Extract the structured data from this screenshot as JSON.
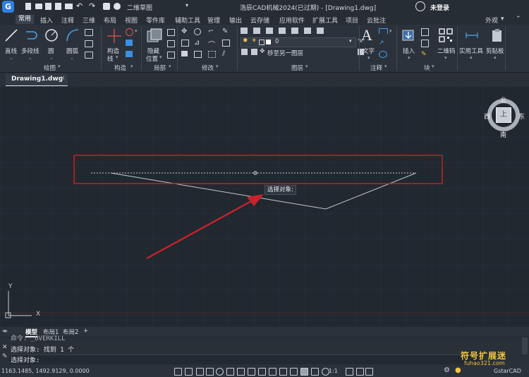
{
  "titlebar": {
    "workspace": "二维草图",
    "title": "浩辰CAD机械2024(已过期) - [Drawing1.dwg]",
    "user": "未登录"
  },
  "ribbon_tabs": [
    "常用",
    "插入",
    "注释",
    "三维",
    "布局",
    "视图",
    "零件库",
    "辅助工具",
    "管理",
    "输出",
    "云存储",
    "应用软件",
    "扩展工具",
    "项目",
    "云批注"
  ],
  "ribbon_right": "外观",
  "tools": {
    "line": "直线",
    "polyline": "多段线",
    "circle": "圆",
    "arc": "圆弧",
    "construct": "构造",
    "construct_line": "线",
    "hide": "隐藏",
    "position": "位置",
    "layer_value": "0",
    "layer_move": "移至另一图层",
    "text": "文字",
    "insert": "插入",
    "qrcode": "二维码",
    "utilities": "实用工具",
    "clipboard": "剪贴板"
  },
  "groups": {
    "draw": "绘图",
    "construct": "构造",
    "local": "局部",
    "modify": "修改",
    "layer": "图层",
    "annotate": "注释",
    "block": "块"
  },
  "document_tab": "Drawing1.dwg",
  "viewcube": {
    "north": "北",
    "south": "南",
    "west": "西",
    "east": "东",
    "face": "上"
  },
  "axes": {
    "x": "X",
    "y": "Y"
  },
  "tooltip": "选择对象:",
  "layout_tabs": [
    "模型",
    "布局1",
    "布局2"
  ],
  "layout_add": "+",
  "command_lines": [
    "命令: _OVERKILL",
    "选择对象: 找到 1 个",
    "选择对象:"
  ],
  "coordinates": "1163.1485, 1492.9129, 0.0000",
  "status_scale": "1:1",
  "brand": "GstarCAD",
  "watermark_title": "符号扩展迷",
  "watermark_url": "fuhao321.com",
  "colors": {
    "canvas": "#212830",
    "highlight_box": "#c9222b",
    "arrow": "#c9222b",
    "accent": "#2f7fe0",
    "watermark": "#f2c53d"
  }
}
